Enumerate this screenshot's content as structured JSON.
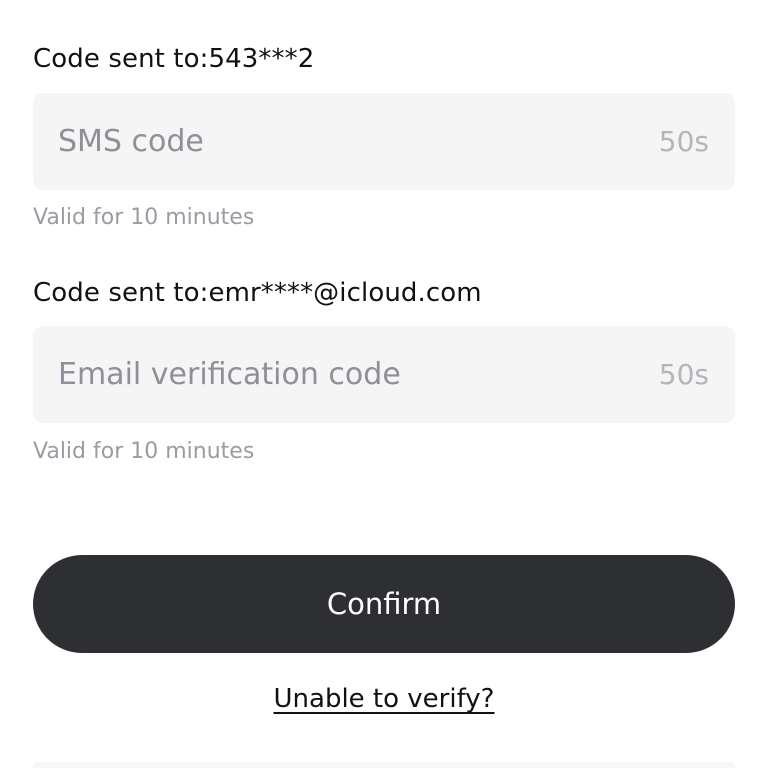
{
  "sms": {
    "sent_label": "Code sent to:543***2",
    "placeholder": "SMS code",
    "countdown": "50s",
    "valid_note": "Valid for 10 minutes"
  },
  "email": {
    "sent_label": "Code sent to:emr****@icloud.com",
    "placeholder": "Email verification code",
    "countdown": "50s",
    "valid_note": "Valid for 10 minutes"
  },
  "actions": {
    "confirm_label": "Confirm",
    "unable_label": "Unable to verify?"
  }
}
